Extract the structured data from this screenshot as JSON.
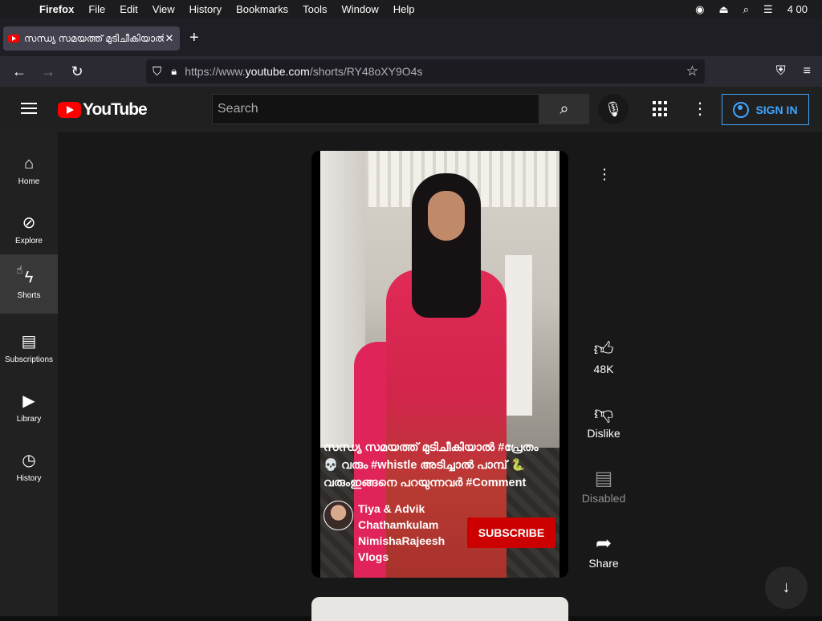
{
  "menubar": {
    "app": "Firefox",
    "items": [
      "File",
      "Edit",
      "View",
      "History",
      "Bookmarks",
      "Tools",
      "Window",
      "Help"
    ],
    "clock": "4 00"
  },
  "tab": {
    "title": "സന്ധ്യ സമയത്ത് മുടിചീകിയാൽ #പ"
  },
  "url": {
    "prefix": "https://www.",
    "host": "youtube.com",
    "path": "/shorts/RY48oXY9O4s"
  },
  "header": {
    "logo_text": "YouTube",
    "search_placeholder": "Search",
    "signin_label": "SIGN IN"
  },
  "sidebar": {
    "items": [
      {
        "label": "Home",
        "icon": "home-icon"
      },
      {
        "label": "Explore",
        "icon": "compass-icon"
      },
      {
        "label": "Shorts",
        "icon": "shorts-icon"
      },
      {
        "label": "Subscriptions",
        "icon": "subscriptions-icon"
      },
      {
        "label": "Library",
        "icon": "library-icon"
      },
      {
        "label": "History",
        "icon": "history-icon"
      }
    ],
    "active": "Shorts"
  },
  "short": {
    "caption_line1": "സന്ധ്യ സമയത്ത് മുടിചീകിയാൽ #പ്രേതം",
    "caption_line2": "💀 വരും #whistle അടിച്ചാൽ പാമ്പ് 🐍",
    "caption_line3": "വരുംഇങ്ങനെ പറയുന്നവർ #Comment",
    "channel_name": "Tiya & Advik Chathamkulam NimishaRajeesh Vlogs",
    "subscribe_label": "SUBSCRIBE"
  },
  "actions": {
    "like_count": "48K",
    "dislike_label": "Dislike",
    "comments_label": "Disabled",
    "share_label": "Share"
  },
  "colors": {
    "yt_red": "#ff0000",
    "subscribe_red": "#cc0000",
    "signin_blue": "#3ea6ff"
  }
}
